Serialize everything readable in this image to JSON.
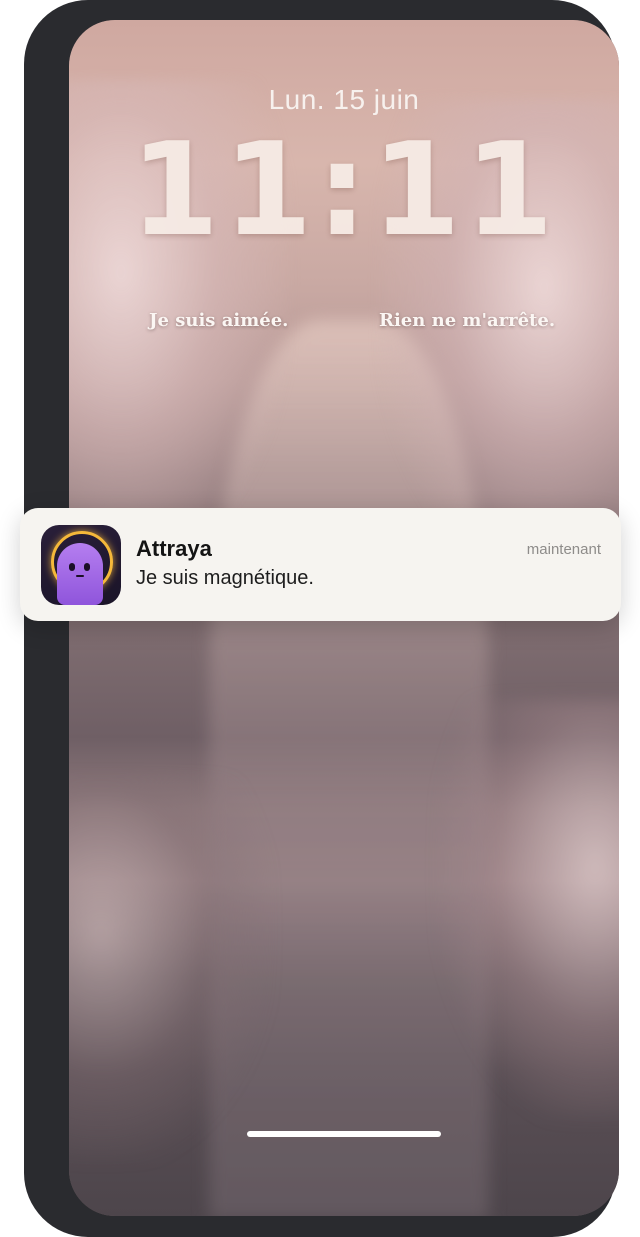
{
  "lockscreen": {
    "date": "Lun. 15 juin",
    "time": "11:11",
    "affirmations": [
      "Je suis aimée.",
      "Rien ne m'arrête."
    ]
  },
  "notification": {
    "app_name": "Attraya",
    "time_label": "maintenant",
    "message": "Je suis magnétique.",
    "app_icon": "purple-creature-halo-icon"
  },
  "colors": {
    "notification_bg": "#f6f4f0",
    "icon_bg": "#1a1428",
    "creature": "#a46be8",
    "halo": "#f5b83a"
  }
}
